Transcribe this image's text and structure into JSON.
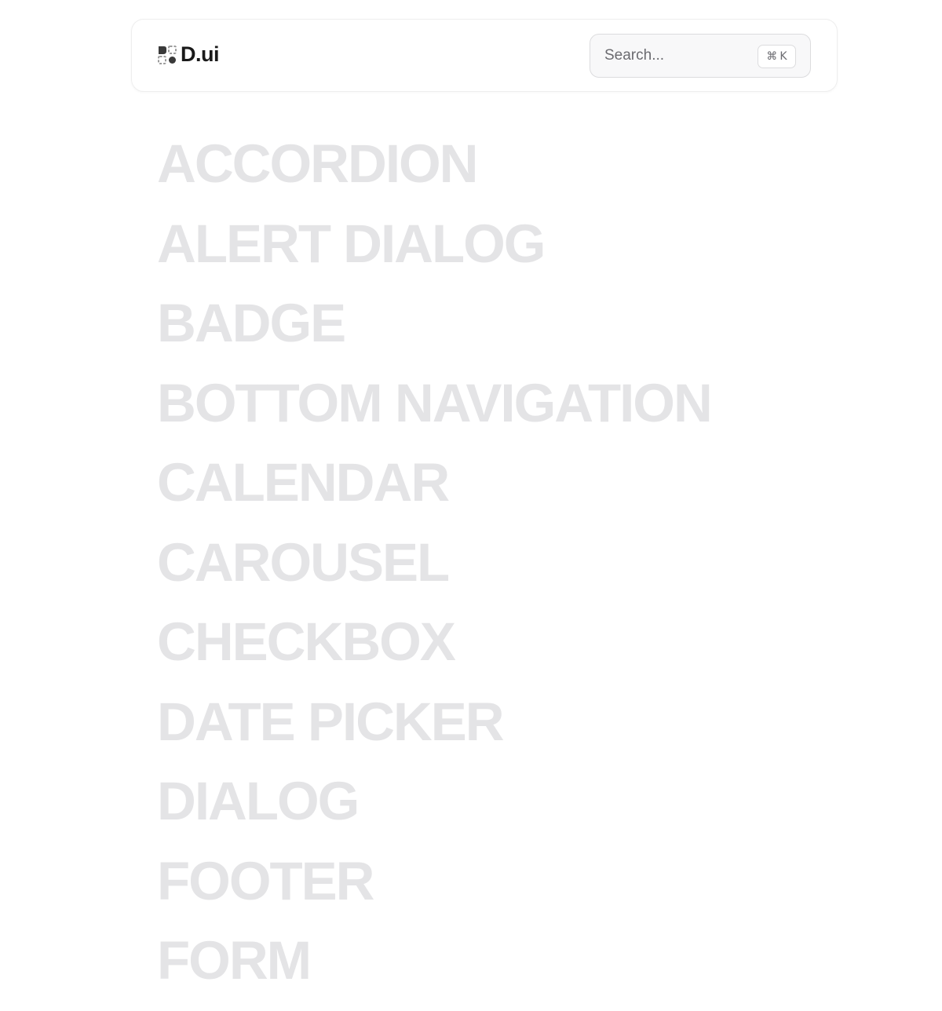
{
  "header": {
    "logo_text": "D.ui",
    "search": {
      "placeholder": "Search...",
      "shortcut_symbol": "⌘",
      "shortcut_key": "K"
    }
  },
  "components": [
    "ACCORDION",
    "ALERT DIALOG",
    "BADGE",
    "BOTTOM NAVIGATION",
    "CALENDAR",
    "CAROUSEL",
    "CHECKBOX",
    "DATE PICKER",
    "DIALOG",
    "FOOTER",
    "FORM"
  ],
  "colors": {
    "list_text": "#e4e4e6",
    "logo_text": "#1a1a1a",
    "search_bg": "#f8f8f9",
    "border": "#dcdcde"
  }
}
